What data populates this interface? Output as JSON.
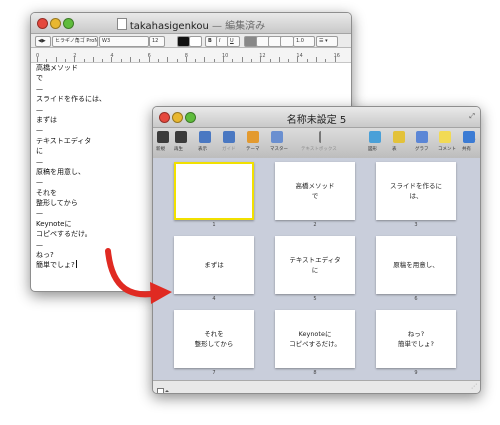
{
  "editor": {
    "title": "takahasigenkou",
    "subtitle": " — 編集済み",
    "toolbar": {
      "style": "◀▶",
      "font": "ヒラギノ角ゴ ProN",
      "weight": "W3",
      "size": "12",
      "spacing": "1.0",
      "list": "☰ ▾"
    },
    "ruler_numbers": [
      "0",
      "2",
      "4",
      "6",
      "8",
      "10",
      "12",
      "14",
      "16"
    ],
    "lines": [
      "高橋メソッド",
      "で",
      "—",
      "スライドを作るには、",
      "—",
      "まずは",
      "—",
      "テキストエディタ",
      "に",
      "—",
      "原稿を用意し、",
      "—",
      "それを",
      "整形してから",
      "—",
      "Keynoteに",
      "コピペするだけ。",
      "—",
      "ねっ?",
      "簡単でしょ?"
    ]
  },
  "keynote": {
    "title": "名称未設定 5",
    "toolbar": [
      {
        "label": "新規",
        "icon": "plus-icon",
        "color": "#3b3b3b"
      },
      {
        "label": "再生",
        "icon": "play-icon",
        "color": "#3b3b3b"
      },
      {
        "label": "表示",
        "icon": "view-icon",
        "color": "#4a78c2"
      },
      {
        "label": "ガイド",
        "icon": "guide-icon",
        "color": "#4a78c2"
      },
      {
        "label": "テーマ",
        "icon": "theme-icon",
        "color": "#e39a2f"
      },
      {
        "label": "マスター",
        "icon": "master-icon",
        "color": "#6a8fd0"
      },
      {
        "label": "テキストボックス",
        "icon": "textbox-icon",
        "color": "#777777"
      },
      {
        "label": "図形",
        "icon": "shape-icon",
        "color": "#4aa0d8"
      },
      {
        "label": "表",
        "icon": "table-icon",
        "color": "#e3c23a"
      },
      {
        "label": "グラフ",
        "icon": "chart-icon",
        "color": "#5b86d6"
      },
      {
        "label": "コメント",
        "icon": "comment-icon",
        "color": "#f2da54"
      },
      {
        "label": "共有",
        "icon": "share-icon",
        "color": "#3b7bd4"
      }
    ],
    "overflow": "»",
    "slides": [
      {
        "num": "1",
        "text": ""
      },
      {
        "num": "2",
        "text": "高橋メソッド\nで"
      },
      {
        "num": "3",
        "text": "スライドを作るに\nは、"
      },
      {
        "num": "4",
        "text": "まずは"
      },
      {
        "num": "5",
        "text": "テキストエディタ\nに"
      },
      {
        "num": "6",
        "text": "原稿を用意し、"
      },
      {
        "num": "7",
        "text": "それを\n整形してから"
      },
      {
        "num": "8",
        "text": "Keynoteに\nコピペするだけ。"
      },
      {
        "num": "9",
        "text": "ねっ?\n簡単でしょ?"
      }
    ]
  },
  "colors": {
    "arrow": "#e02a22",
    "selection": "#f1e000"
  }
}
